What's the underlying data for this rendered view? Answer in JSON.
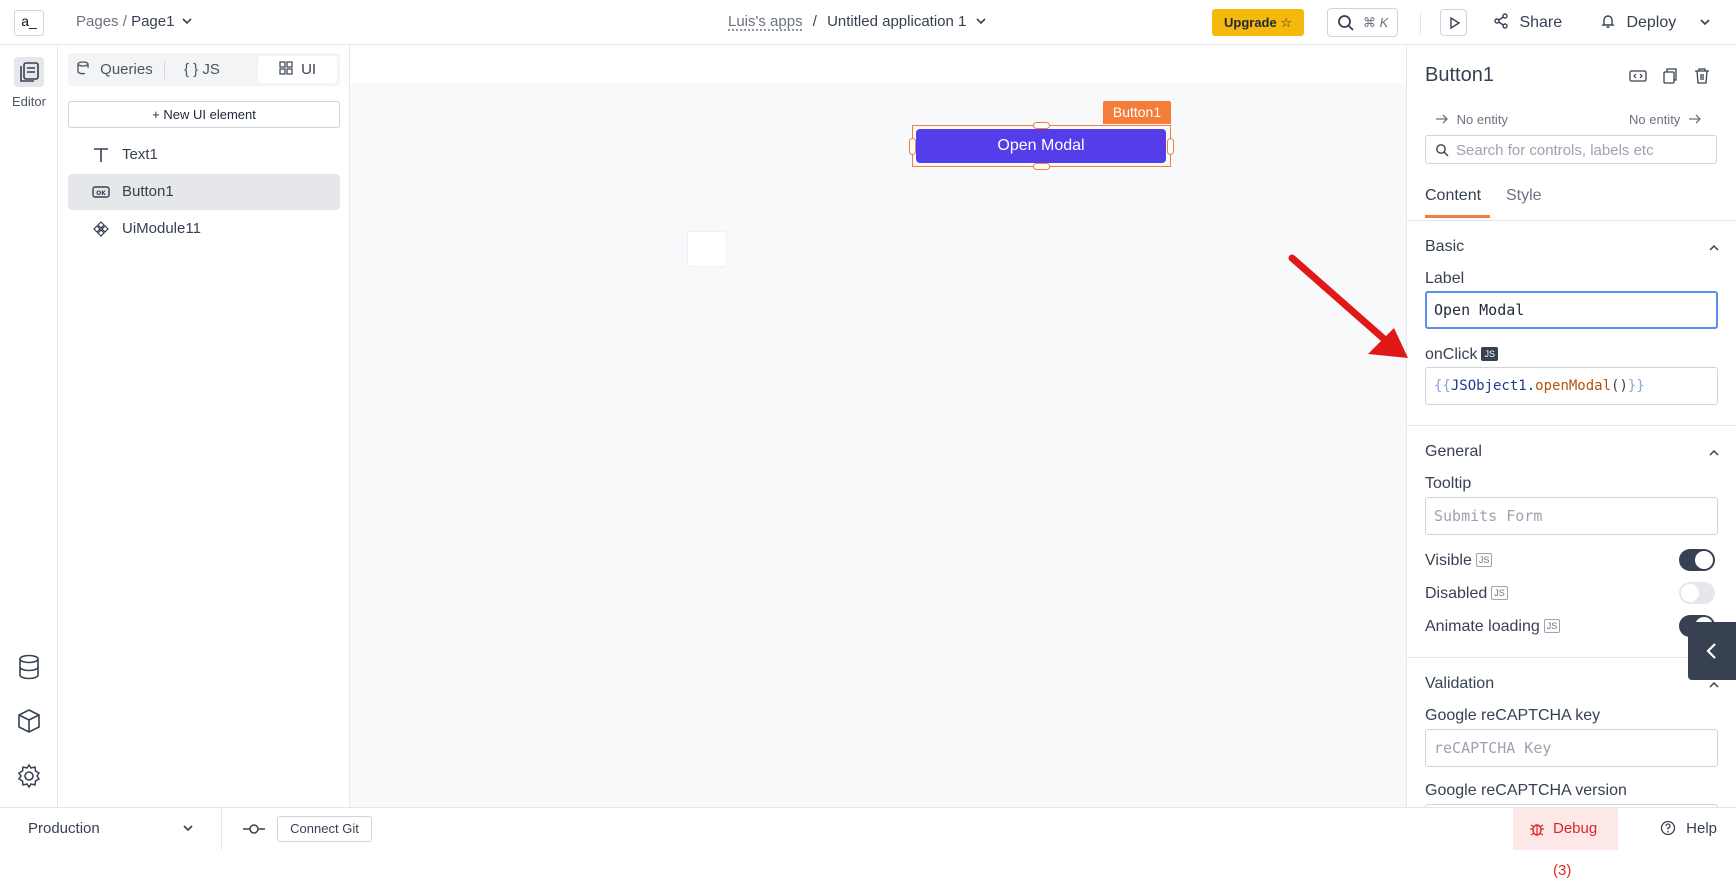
{
  "header": {
    "logo_text": "a_",
    "breadcrumb_pages": "Pages",
    "breadcrumb_sep": "/",
    "breadcrumb_page": "Page1",
    "workspace": "Luis's apps",
    "app_sep": "/",
    "app_name": "Untitled application 1",
    "upgrade_label": "Upgrade ☆",
    "search_shortcut": "⌘ K",
    "share_label": "Share",
    "deploy_label": "Deploy"
  },
  "rail": {
    "editor_label": "Editor"
  },
  "explorer": {
    "tabs": [
      {
        "label": "Queries"
      },
      {
        "label": "{ } JS"
      },
      {
        "label": "UI"
      }
    ],
    "new_ui_label": "+ New UI element",
    "items": [
      {
        "label": "Text1",
        "icon": "text-icon"
      },
      {
        "label": "Button1",
        "icon": "button-icon",
        "selected": true
      },
      {
        "label": "UiModule11",
        "icon": "module-icon"
      }
    ]
  },
  "canvas": {
    "selected_tag": "Button1",
    "button_label": "Open Modal"
  },
  "props": {
    "title": "Button1",
    "entity_left": "No entity",
    "entity_right": "No entity",
    "search_placeholder": "Search for controls, labels etc",
    "tabs": {
      "content": "Content",
      "style": "Style"
    },
    "basic": {
      "heading": "Basic",
      "label_label": "Label",
      "label_value": "Open Modal",
      "onclick_label": "onClick",
      "onclick_open": "{{",
      "onclick_obj": "JSObject1.",
      "onclick_fn": "openModal",
      "onclick_paren": "()",
      "onclick_close": "}}"
    },
    "general": {
      "heading": "General",
      "tooltip_label": "Tooltip",
      "tooltip_placeholder": "Submits Form",
      "visible_label": "Visible",
      "visible": true,
      "disabled_label": "Disabled",
      "disabled": false,
      "animate_label": "Animate loading",
      "animate": true
    },
    "validation": {
      "heading": "Validation",
      "recaptcha_key_label": "Google reCAPTCHA key",
      "recaptcha_key_placeholder": "reCAPTCHA Key",
      "recaptcha_version_label": "Google reCAPTCHA version"
    },
    "js_badge": "JS"
  },
  "bottombar": {
    "environment": "Production",
    "connect_git": "Connect Git",
    "debug_label": "Debug (3)",
    "help_label": "Help"
  },
  "colors": {
    "accent": "#f47d3a",
    "button": "#553de9",
    "upgrade": "#f5b90e",
    "debug": "#dc2626",
    "annotation_arrow": "#e01818"
  }
}
